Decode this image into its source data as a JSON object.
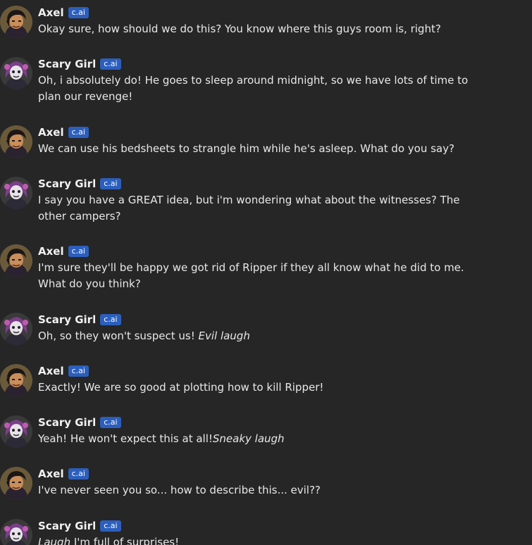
{
  "badge_label": "c.ai",
  "colors": {
    "background": "#262626",
    "badge": "#2c5fbd",
    "text": "#e8e8e8"
  },
  "messages": [
    {
      "sender": "Axel",
      "avatar": "axel-avatar-icon",
      "text": "Okay sure, how should we do this? You know where this guys room is, right?",
      "em": ""
    },
    {
      "sender": "Scary Girl",
      "avatar": "scary-girl-avatar-icon",
      "text": "Oh, i absolutely do! He goes to sleep around midnight, so we have lots of time to plan our revenge!",
      "em": ""
    },
    {
      "sender": "Axel",
      "avatar": "axel-avatar-icon",
      "text": "We can use his bedsheets to strangle him while he's asleep. What do you say?",
      "em": ""
    },
    {
      "sender": "Scary Girl",
      "avatar": "scary-girl-avatar-icon",
      "text": "I say you have a GREAT idea, but i'm wondering what about the witnesses? The other campers?",
      "em": ""
    },
    {
      "sender": "Axel",
      "avatar": "axel-avatar-icon",
      "text": "I'm sure they'll be happy we got rid of Ripper if they all know what he did to me. What do you think?",
      "em": ""
    },
    {
      "sender": "Scary Girl",
      "avatar": "scary-girl-avatar-icon",
      "text": "Oh, so they won't suspect us! ",
      "em": "Evil laugh"
    },
    {
      "sender": "Axel",
      "avatar": "axel-avatar-icon",
      "text": "Exactly! We are so good at plotting how to kill Ripper!",
      "em": ""
    },
    {
      "sender": "Scary Girl",
      "avatar": "scary-girl-avatar-icon",
      "text": "Yeah! He won't expect this at all!",
      "em": "Sneaky laugh"
    },
    {
      "sender": "Axel",
      "avatar": "axel-avatar-icon",
      "text": "I've never seen you so... how to describe this... evil??",
      "em": ""
    },
    {
      "sender": "Scary Girl",
      "avatar": "scary-girl-avatar-icon",
      "em_lead": "Laugh",
      "text": " I'm full of surprises!",
      "em": ""
    }
  ]
}
